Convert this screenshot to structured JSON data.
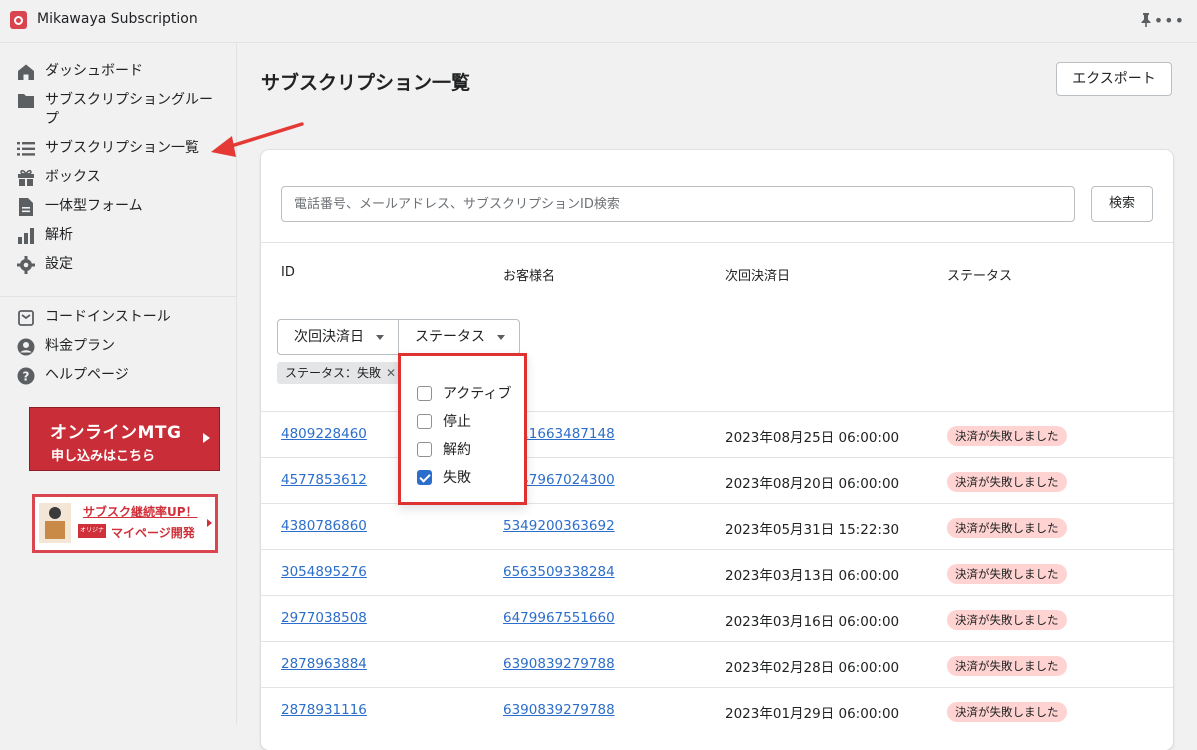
{
  "app": {
    "title": "Mikawaya Subscription"
  },
  "sidebar": {
    "items": [
      {
        "label": "ダッシュボード",
        "icon": "home-icon"
      },
      {
        "label": "サブスクリプショングループ",
        "icon": "folder-icon"
      },
      {
        "label": "サブスクリプション一覧",
        "icon": "list-icon"
      },
      {
        "label": "ボックス",
        "icon": "gift-icon"
      },
      {
        "label": "一体型フォーム",
        "icon": "document-icon"
      },
      {
        "label": "解析",
        "icon": "analytics-icon"
      },
      {
        "label": "設定",
        "icon": "gear-icon"
      }
    ],
    "secondary": [
      {
        "label": "コードインストール",
        "icon": "code-icon"
      },
      {
        "label": "料金プラン",
        "icon": "user-circle-icon"
      },
      {
        "label": "ヘルプページ",
        "icon": "help-icon"
      }
    ],
    "banner_mtg": {
      "line1": "オンラインMTG",
      "line2": "申し込みはこちら"
    },
    "banner_sub": {
      "line1": "サブスク継続率UP！",
      "tag": "オリジナル",
      "line2": "マイページ開発"
    }
  },
  "main": {
    "title": "サブスクリプション一覧",
    "export_label": "エクスポート",
    "search": {
      "placeholder": "電話番号、メールアドレス、サブスクリプションID検索",
      "button": "検索"
    },
    "columns": [
      "ID",
      "お客様名",
      "次回決済日",
      "ステータス"
    ],
    "filters": {
      "next_payment": "次回決済日",
      "status": "ステータス"
    },
    "chip": "ステータス：失敗",
    "status_options": [
      {
        "label": "アクティブ",
        "checked": false
      },
      {
        "label": "停止",
        "checked": false
      },
      {
        "label": "解約",
        "checked": false
      },
      {
        "label": "失敗",
        "checked": true
      }
    ],
    "rows": [
      {
        "id": "4809228460",
        "customer": "6611663487148",
        "date": "2023年08月25日 06:00:00",
        "status": "決済が失敗しました"
      },
      {
        "id": "4577853612",
        "customer": "6447967024300",
        "date": "2023年08月20日 06:00:00",
        "status": "決済が失敗しました"
      },
      {
        "id": "4380786860",
        "customer": "5349200363692",
        "date": "2023年05月31日 15:22:30",
        "status": "決済が失敗しました"
      },
      {
        "id": "3054895276",
        "customer": "6563509338284",
        "date": "2023年03月13日 06:00:00",
        "status": "決済が失敗しました"
      },
      {
        "id": "2977038508",
        "customer": "6479967551660",
        "date": "2023年03月16日 06:00:00",
        "status": "決済が失敗しました"
      },
      {
        "id": "2878963884",
        "customer": "6390839279788",
        "date": "2023年02月28日 06:00:00",
        "status": "決済が失敗しました"
      },
      {
        "id": "2878931116",
        "customer": "6390839279788",
        "date": "2023年01月29日 06:00:00",
        "status": "決済が失敗しました"
      }
    ]
  }
}
